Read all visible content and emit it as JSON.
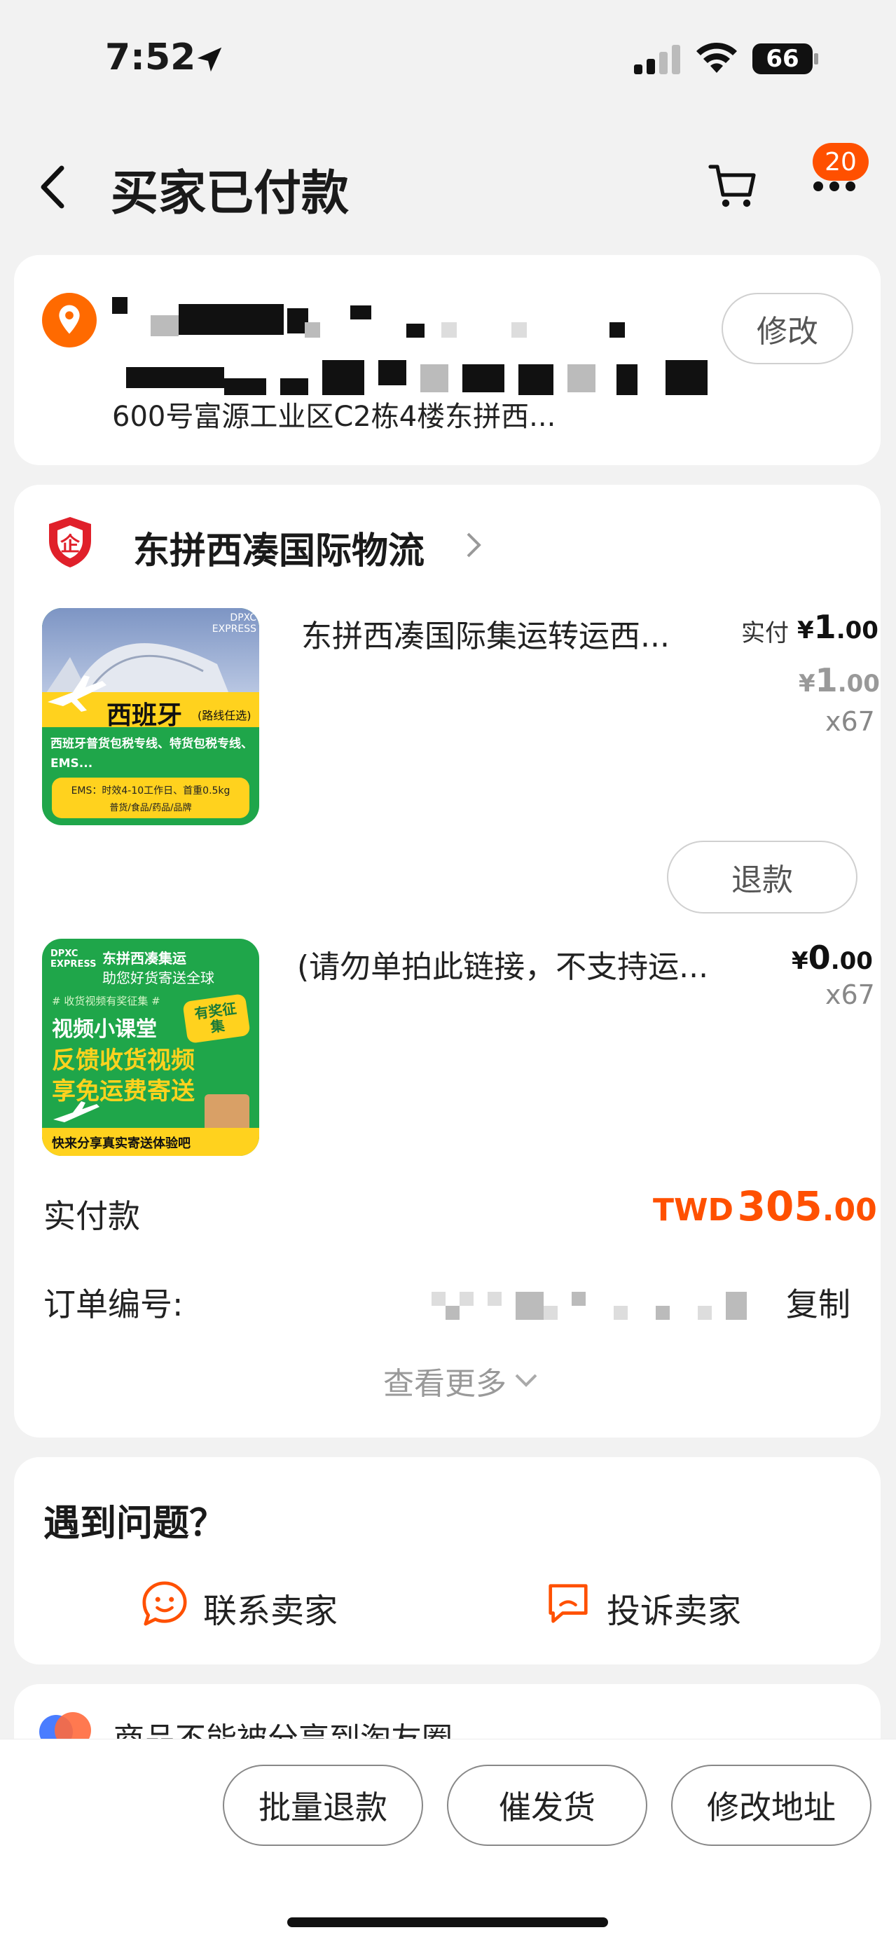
{
  "status_bar": {
    "time": "7:52",
    "battery": "66"
  },
  "header": {
    "title": "买家已付款",
    "cart_badge": "20"
  },
  "address": {
    "line3": "600号富源工业区C2栋4楼东拼西...",
    "edit_label": "修改"
  },
  "shop": {
    "name": "东拼西凑国际物流"
  },
  "items": [
    {
      "title": "东拼西凑国际集运转运西...",
      "paid_label": "实付",
      "paid_currency": "¥",
      "paid_int": "1",
      "paid_dec": ".00",
      "orig_currency": "¥",
      "orig_int": "1",
      "orig_dec": ".00",
      "qty": "x67",
      "refund_label": "退款",
      "thumb": {
        "brand": "DPXC EXPRESS",
        "country": "西班牙",
        "route_note": "(路线任选)",
        "desc": "西班牙普货包税专线、特货包税专线、EMS...",
        "ems_line1": "EMS：时效4-10工作日、首重0.5kg",
        "ems_line2": "普货/食品/药品/品牌"
      }
    },
    {
      "title": "(请勿单拍此链接，不支持运...",
      "price_currency": "¥",
      "price_int": "0",
      "price_dec": ".00",
      "qty": "x67",
      "thumb": {
        "brand": "DPXC EXPRESS",
        "company": "东拼西凑集运",
        "slogan": "助您好货寄送全球",
        "tag": "# 收货视频有奖征集 #",
        "badge": "有奖征集",
        "line1": "视频小课堂",
        "line2": "反馈收货视频",
        "line3": "享免运费寄送",
        "footer": "快来分享真实寄送体验吧"
      }
    }
  ],
  "totals": {
    "label": "实付款",
    "currency": "TWD",
    "amount_int": "305",
    "amount_dec": ".00"
  },
  "order": {
    "number_label": "订单编号:",
    "copy_label": "复制"
  },
  "view_more": "查看更多",
  "help": {
    "title": "遇到问题？",
    "contact": "联系卖家",
    "complain": "投诉卖家"
  },
  "share_notice": "商品不能被分享到淘友圈",
  "bottom_actions": {
    "batch_refund": "批量退款",
    "urge_ship": "催发货",
    "change_address": "修改地址"
  },
  "colors": {
    "accent": "#ff5000",
    "price_orange": "#ff5000",
    "thumb_green": "#1fa64a",
    "thumb_yellow": "#ffd21e"
  }
}
